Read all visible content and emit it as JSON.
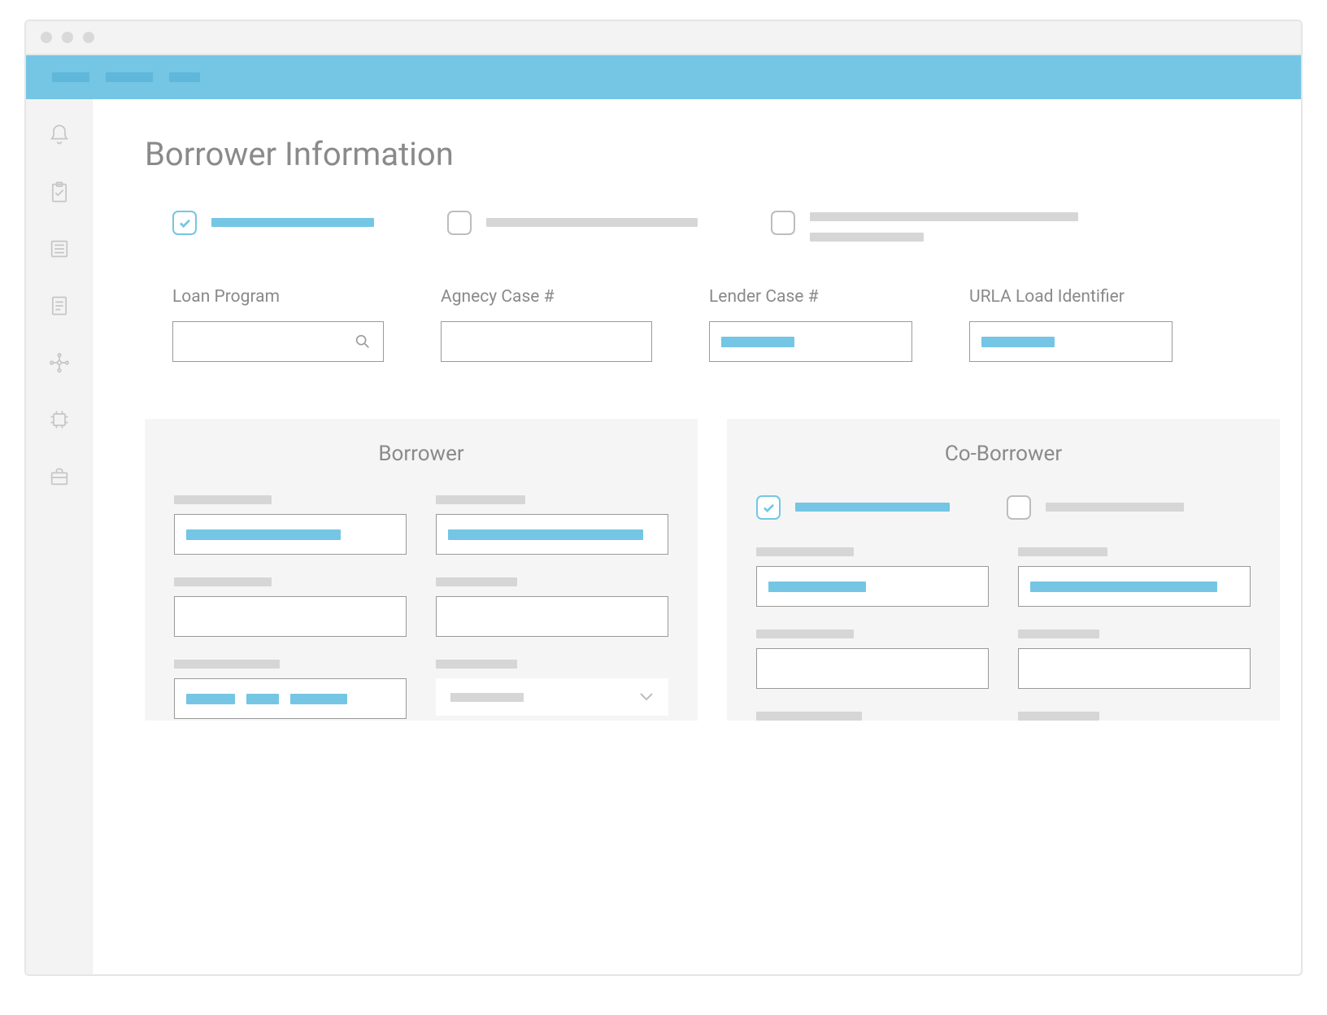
{
  "page": {
    "title": "Borrower Information"
  },
  "fields": {
    "loan_program": {
      "label": "Loan Program"
    },
    "agency_case": {
      "label": "Agnecy Case #"
    },
    "lender_case": {
      "label": "Lender Case #"
    },
    "urla_id": {
      "label": "URLA Load Identifier"
    }
  },
  "panels": {
    "borrower": {
      "title": "Borrower"
    },
    "coborrower": {
      "title": "Co-Borrower"
    }
  }
}
